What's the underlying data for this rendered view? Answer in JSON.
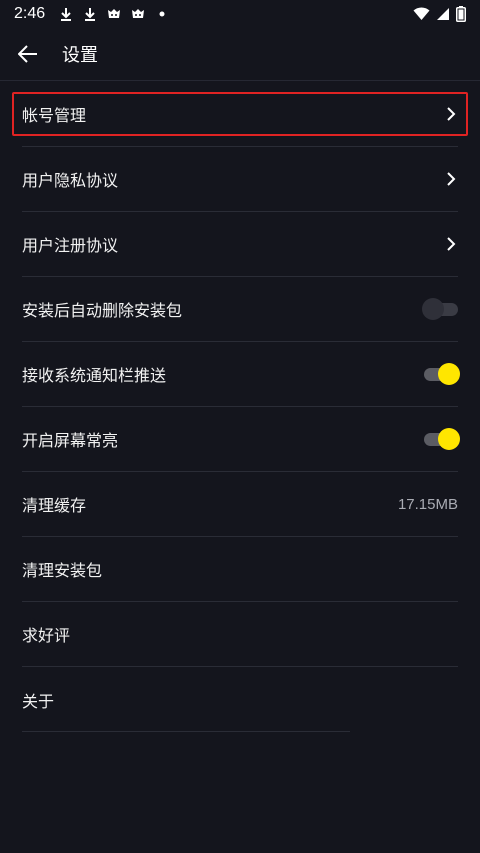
{
  "status_bar": {
    "time": "2:46",
    "left_icons": [
      "download-icon",
      "download-icon",
      "app-notification-icon",
      "app-notification-icon",
      "dot-icon"
    ],
    "right_icons": [
      "wifi-icon",
      "cell-signal-icon",
      "battery-icon"
    ]
  },
  "header": {
    "back_icon": "arrow-left-icon",
    "title": "设置"
  },
  "settings": {
    "account": {
      "label": "帐号管理",
      "highlighted": true,
      "highlight_color": "#e02323"
    },
    "privacy": {
      "label": "用户隐私协议"
    },
    "register": {
      "label": "用户注册协议"
    },
    "auto_delete": {
      "label": "安装后自动删除安装包",
      "enabled": false
    },
    "notify": {
      "label": "接收系统通知栏推送",
      "enabled": true
    },
    "screen_on": {
      "label": "开启屏幕常亮",
      "enabled": true
    },
    "clear_cache": {
      "label": "清理缓存",
      "value": "17.15MB"
    },
    "clear_packages": {
      "label": "清理安装包"
    },
    "rate": {
      "label": "求好评"
    },
    "about": {
      "label": "关于"
    }
  },
  "colors": {
    "background": "#14151d",
    "toggle_on": "#ffe600",
    "divider": "#2a2c36"
  }
}
